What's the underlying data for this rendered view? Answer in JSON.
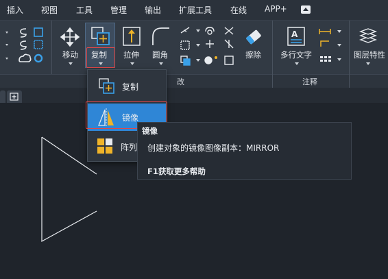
{
  "menubar": {
    "items": [
      "插入",
      "视图",
      "工具",
      "管理",
      "输出",
      "扩展工具",
      "在线",
      "APP+"
    ]
  },
  "ribbon": {
    "move_label": "移动",
    "copy_label": "复制",
    "stretch_label": "拉伸",
    "fillet_label": "圆角",
    "erase_label": "擦除",
    "mtext_label": "多行文字",
    "layer_props_label": "图层特性",
    "modify_panel_label": "改",
    "annotate_panel_label": "注释"
  },
  "dropdown": {
    "items": [
      {
        "label": "复制"
      },
      {
        "label": "镜像"
      },
      {
        "label": "阵列"
      }
    ]
  },
  "tooltip": {
    "title": "镜像",
    "description": "创建对象的镜像图像副本：MIRROR",
    "help": "F1获取更多帮助"
  },
  "colors": {
    "accent": "#2f86d6",
    "highlight_border": "#e04848",
    "background": "#1f242b"
  }
}
